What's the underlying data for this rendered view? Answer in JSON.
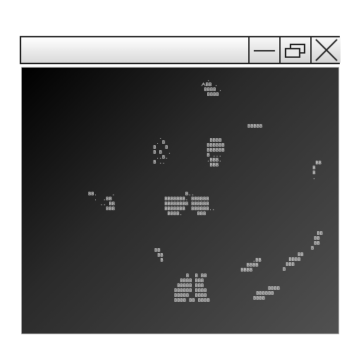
{
  "window": {
    "buttons": [
      {
        "name": "minimize-icon"
      },
      {
        "name": "restore-icon"
      },
      {
        "name": "close-icon"
      }
    ]
  },
  "art": {
    "glyph_char": "B"
  }
}
